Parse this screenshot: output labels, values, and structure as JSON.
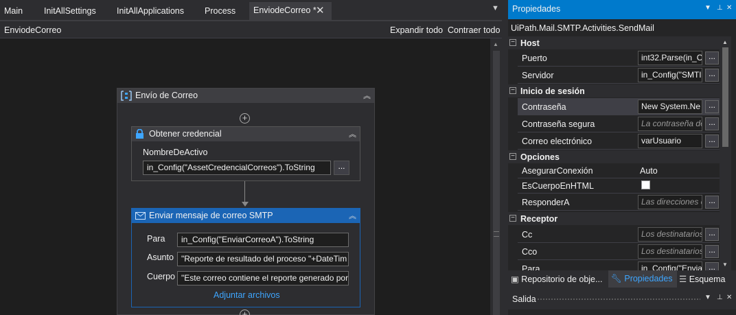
{
  "tabs": [
    {
      "label": "Main"
    },
    {
      "label": "InitAllSettings"
    },
    {
      "label": "InitAllApplications"
    },
    {
      "label": "Process"
    },
    {
      "label": "EnviodeCorreo *"
    }
  ],
  "designer": {
    "breadcrumb": "EnviodeCorreo",
    "expand_all": "Expandir todo",
    "collapse_all": "Contraer todo"
  },
  "sequence": {
    "title": "Envío de Correo",
    "get_credential": {
      "title": "Obtener credencial",
      "asset_label": "NombreDeActivo",
      "asset_value": "in_Config(\"AssetCredencialCorreos\").ToString",
      "button": "..."
    },
    "send_smtp": {
      "title": "Enviar mensaje de correo SMTP",
      "to_label": "Para",
      "to_value": "in_Config(\"EnviarCorreoA\").ToString",
      "subject_label": "Asunto",
      "subject_value": "\"Reporte de resultado del proceso \"+DateTim",
      "body_label": "Cuerpo",
      "body_value": "\"Este correo contiene el reporte generado por",
      "attach_link": "Adjuntar archivos"
    }
  },
  "properties": {
    "title": "Propiedades",
    "activity_type": "UiPath.Mail.SMTP.Activities.SendMail",
    "categories": [
      {
        "label": "Host",
        "rows": [
          {
            "name": "Puerto",
            "value": "int32.Parse(in_C",
            "button": "..."
          },
          {
            "name": "Servidor",
            "value": "in_Config(\"SMTI",
            "button": "..."
          }
        ]
      },
      {
        "label": "Inicio de sesión",
        "rows": [
          {
            "name": "Contraseña",
            "value": "New System.Ne",
            "button": "..."
          },
          {
            "name": "Contraseña segura",
            "value": "La contraseña de",
            "button": "..."
          },
          {
            "name": "Correo electrónico",
            "value": "varUsuario",
            "button": "..."
          }
        ]
      },
      {
        "label": "Opciones",
        "rows": [
          {
            "name": "AsegurarConexión",
            "value": "Auto"
          },
          {
            "name": "EsCuerpoEnHTML",
            "value": "false"
          },
          {
            "name": "ResponderA",
            "value": "Las direcciones c",
            "button": "..."
          }
        ]
      },
      {
        "label": "Receptor",
        "rows": [
          {
            "name": "Cc",
            "value": "Los destinatarios",
            "button": "..."
          },
          {
            "name": "Cco",
            "value": "Los destinatarios",
            "button": "..."
          },
          {
            "name": "Para",
            "value": "in_Config(\"Envia",
            "button": "..."
          }
        ]
      }
    ]
  },
  "bottom_tabs": [
    {
      "label": "Repositorio de obje..."
    },
    {
      "label": "Propiedades"
    },
    {
      "label": "Esquema"
    }
  ],
  "output_panel": {
    "title": "Salida"
  },
  "colors": {
    "accent": "#007acc",
    "activity_header_blue": "#1b65b5",
    "link": "#3ea6ff",
    "background": "#1e1e1e"
  }
}
